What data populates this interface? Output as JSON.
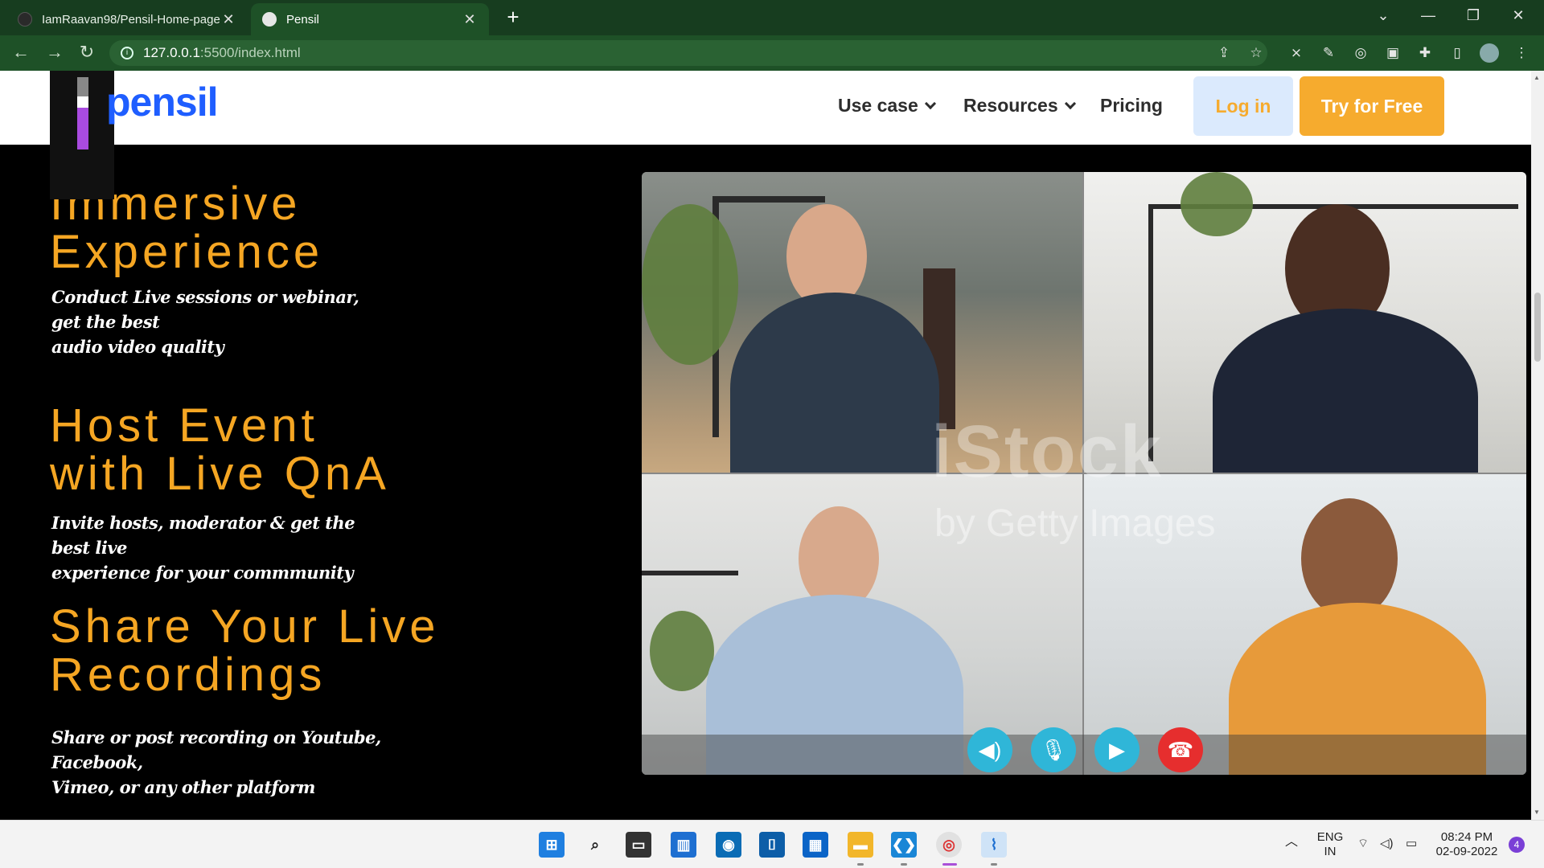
{
  "browser": {
    "tabs": [
      {
        "title": "IamRaavan98/Pensil-Home-page",
        "active": false
      },
      {
        "title": "Pensil",
        "active": true
      }
    ],
    "url_host": "127.0.0.1",
    "url_path": ":5500/index.html"
  },
  "site": {
    "logo": "pensil",
    "nav": [
      {
        "label": "Use case",
        "has_dropdown": true
      },
      {
        "label": "Resources",
        "has_dropdown": true
      },
      {
        "label": "Pricing",
        "has_dropdown": false
      }
    ],
    "login_label": "Log in",
    "cta_label": "Try for Free",
    "accent_color": "#f6ab2e",
    "brand_color": "#1f5eff"
  },
  "features": [
    {
      "title_line1": "Immersive",
      "title_line2": "Experience",
      "desc_line1": "Conduct Live sessions or webinar, get the best",
      "desc_line2": "audio video quality"
    },
    {
      "title_line1": "Host Event",
      "title_line2": "with Live QnA",
      "desc_line1": "Invite hosts, moderator & get the best live",
      "desc_line2": "experience for your commmunity"
    },
    {
      "title_line1": "Share Your Live",
      "title_line2": "Recordings",
      "desc_line1": "Share or post recording on Youtube, Facebook,",
      "desc_line2": "Vimeo, or any other platform"
    }
  ],
  "hero_image": {
    "watermark_line1": "iStock",
    "watermark_line2": "by Getty Images",
    "controls": [
      "speaker-icon",
      "microphone-icon",
      "video-camera-icon",
      "end-call-icon"
    ]
  },
  "taskbar": {
    "language_line1": "ENG",
    "language_line2": "IN",
    "time": "08:24 PM",
    "date": "02-09-2022",
    "notification_count": "4"
  }
}
